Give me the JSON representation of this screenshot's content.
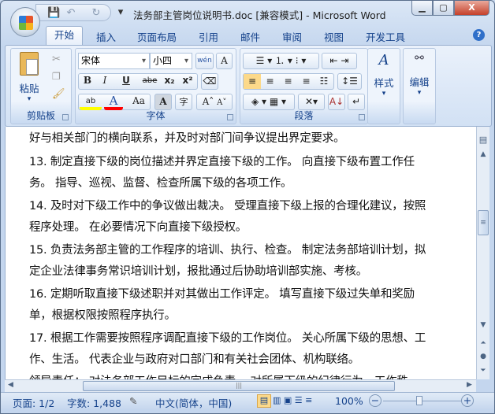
{
  "window": {
    "title": "法务部主管岗位说明书.doc [兼容模式] - Microsoft Word"
  },
  "qat": {
    "save": "💾",
    "undo": "↶",
    "redo": "↻",
    "more": "▾"
  },
  "caption": {
    "minimize": "▁",
    "maximize": "▢",
    "close": "X"
  },
  "tabs": [
    "开始",
    "插入",
    "页面布局",
    "引用",
    "邮件",
    "审阅",
    "视图",
    "开发工具"
  ],
  "ribbon": {
    "clipboard": {
      "label": "剪贴板",
      "paste": "粘贴"
    },
    "font": {
      "label": "字体",
      "font_name": "宋体",
      "font_size": "小四",
      "bold": "B",
      "italic": "I",
      "underline": "U",
      "strike": "abe",
      "sub": "x₂",
      "sup": "x²",
      "grow": "A˄",
      "shrink": "A˅",
      "case": "Aa",
      "char_shade": "A",
      "enclose": "字",
      "phonetic": "wén",
      "border_a": "A",
      "font_color": "A",
      "highlight": "ab"
    },
    "paragraph": {
      "label": "段落"
    },
    "styles": {
      "label": "样式"
    },
    "editing": {
      "label": "编辑"
    }
  },
  "colors": {
    "highlight": "#ffff00",
    "font_color": "#ff0000"
  },
  "document": {
    "lines": [
      "好与相关部门的横向联系，并及时对部门间争议提出界定要求。",
      "13. 制定直接下级的岗位描述并界定直接下级的工作。 向直接下级布置工作任",
      "务。 指导、巡视、监督、检查所属下级的各项工作。",
      "14. 及时对下级工作中的争议做出裁决。 受理直接下级上报的合理化建议，按照",
      "程序处理。 在必要情况下向直接下级授权。",
      "15. 负责法务部主管的工作程序的培训、执行、检查。 制定法务部培训计划，拟",
      "定企业法律事务常识培训计划，报批通过后协助培训部实施、考核。",
      "16. 定期听取直接下级述职并对其做出工作评定。 填写直接下级过失单和奖励",
      "单，根据权限按照程序执行。",
      "17. 根据工作需要按照程序调配直接下级的工作岗位。 关心所属下级的思想、工",
      "作、生活。 代表企业与政府对口部门和有关社会团体、机构联络。",
      "领导责任： 对法务部工作目标的完成负责。 对所属下级的纪律行为、工作秩"
    ]
  },
  "status": {
    "page": "页面: 1/2",
    "words": "字数: 1,488",
    "language": "中文(简体，中国)",
    "zoom": "100%",
    "zoom_value": 100
  }
}
